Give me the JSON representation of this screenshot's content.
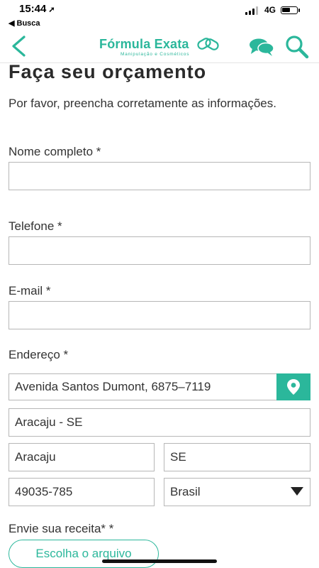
{
  "status_bar": {
    "time": "15:44",
    "back_label": "◀ Busca",
    "network": "4G"
  },
  "header": {
    "brand": "Fórmula Exata",
    "brand_subtitle": "Manipulação e Cosméticos",
    "accent_color": "#2bb79b"
  },
  "page": {
    "title": "Faça seu orçamento",
    "intro": "Por favor, preencha corretamente as informações."
  },
  "form": {
    "name_label": "Nome completo *",
    "name_value": "",
    "phone_label": "Telefone *",
    "phone_value": "",
    "email_label": "E-mail *",
    "email_value": "",
    "address_label": "Endereço *",
    "street_value": "Avenida Santos Dumont, 6875–7119",
    "neighborhood_value": "Aracaju - SE",
    "city_value": "Aracaju",
    "state_value": "SE",
    "zip_value": "49035-785",
    "country_value": "Brasil",
    "prescription_label": "Envie sua receita* *",
    "file_button": "Escolha o arquivo"
  },
  "icons": [
    "back-arrow-icon",
    "chat-icon",
    "search-icon",
    "location-pin-icon",
    "dropdown-arrow-icon"
  ]
}
